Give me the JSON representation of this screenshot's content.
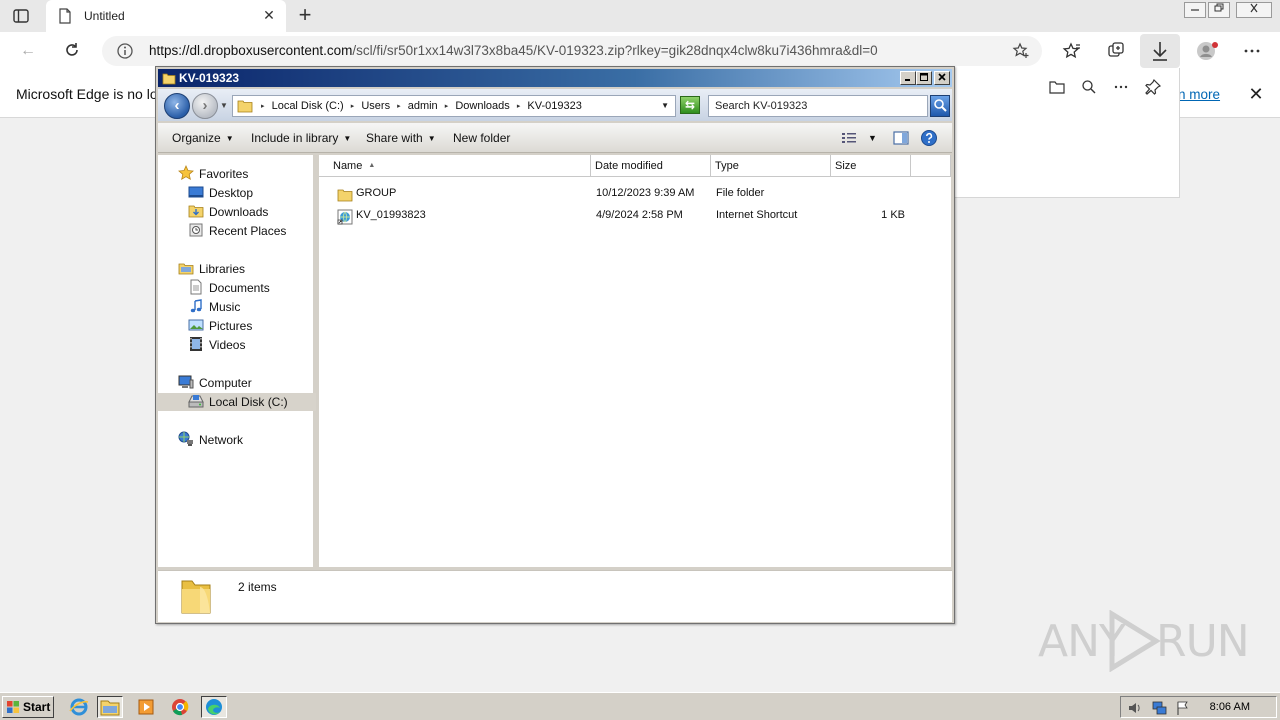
{
  "browser": {
    "tab_title": "Untitled",
    "tab_close": "✕",
    "new_tab": "+",
    "url_host": "https://dl.dropboxusercontent.com",
    "url_path": "/scl/fi/sr50r1xx14w3l73x8ba45/KV-019323.zip?rlkey=gik28dnqx4clw8ku7i436hmra&dl=0",
    "infobar_text": "Microsoft Edge is no lon",
    "infobar_link": "arn more",
    "infobar_close": "✕"
  },
  "explorer": {
    "title": "KV-019323",
    "breadcrumbs": [
      "Local Disk (C:)",
      "Users",
      "admin",
      "Downloads",
      "KV-019323"
    ],
    "search_placeholder": "Search KV-019323",
    "toolbar": {
      "organize": "Organize",
      "include_in_library": "Include in library",
      "share_with": "Share with",
      "new_folder": "New folder"
    },
    "nav": {
      "favorites": "Favorites",
      "desktop": "Desktop",
      "downloads": "Downloads",
      "recent_places": "Recent Places",
      "libraries": "Libraries",
      "documents": "Documents",
      "music": "Music",
      "pictures": "Pictures",
      "videos": "Videos",
      "computer": "Computer",
      "local_disk": "Local Disk (C:)",
      "network": "Network"
    },
    "columns": {
      "name": "Name",
      "date_modified": "Date modified",
      "type": "Type",
      "size": "Size"
    },
    "files": [
      {
        "name": "GROUP",
        "date": "10/12/2023 9:39 AM",
        "type": "File folder",
        "size": ""
      },
      {
        "name": "KV_01993823",
        "date": "4/9/2024 2:58 PM",
        "type": "Internet Shortcut",
        "size": "1 KB"
      }
    ],
    "item_count": "2 items"
  },
  "taskbar": {
    "start": "Start",
    "clock": "8:06 AM"
  },
  "watermark": {
    "left": "ANY",
    "right": "RUN"
  }
}
